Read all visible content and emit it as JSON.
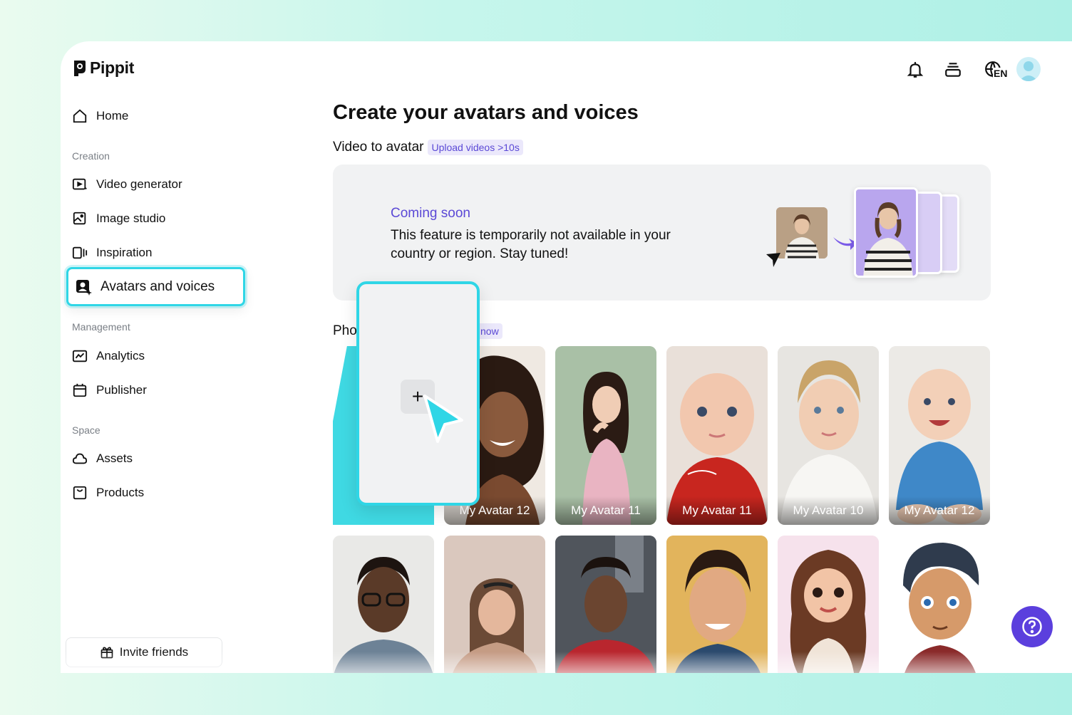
{
  "brand": {
    "name": "Pippit"
  },
  "sidebar": {
    "home": "Home",
    "creation_label": "Creation",
    "video_generator": "Video generator",
    "image_studio": "Image studio",
    "inspiration": "Inspiration",
    "avatars_voices": "Avatars and voices",
    "management_label": "Management",
    "analytics": "Analytics",
    "publisher": "Publisher",
    "space_label": "Space",
    "assets": "Assets",
    "products": "Products",
    "invite": "Invite friends"
  },
  "topbar": {
    "language": "EN"
  },
  "main": {
    "title": "Create your avatars and voices",
    "video_to_avatar": "Video to avatar",
    "upload_tag": "Upload videos >10s",
    "coming_soon": "Coming soon",
    "notice": "This feature is temporarily not available in your country or region. Stay tuned!",
    "photo_section_prefix": "Pho",
    "photo_tag_suffix": "now",
    "avatars_row1": [
      {
        "label": "My Avatar 12"
      },
      {
        "label": "My Avatar 11"
      },
      {
        "label": "My Avatar 11"
      },
      {
        "label": "My Avatar 10"
      },
      {
        "label": "My Avatar 12"
      }
    ]
  },
  "colors": {
    "accent": "#5b49d6",
    "highlight": "#2fd6e6",
    "help": "#5b3fdd"
  }
}
